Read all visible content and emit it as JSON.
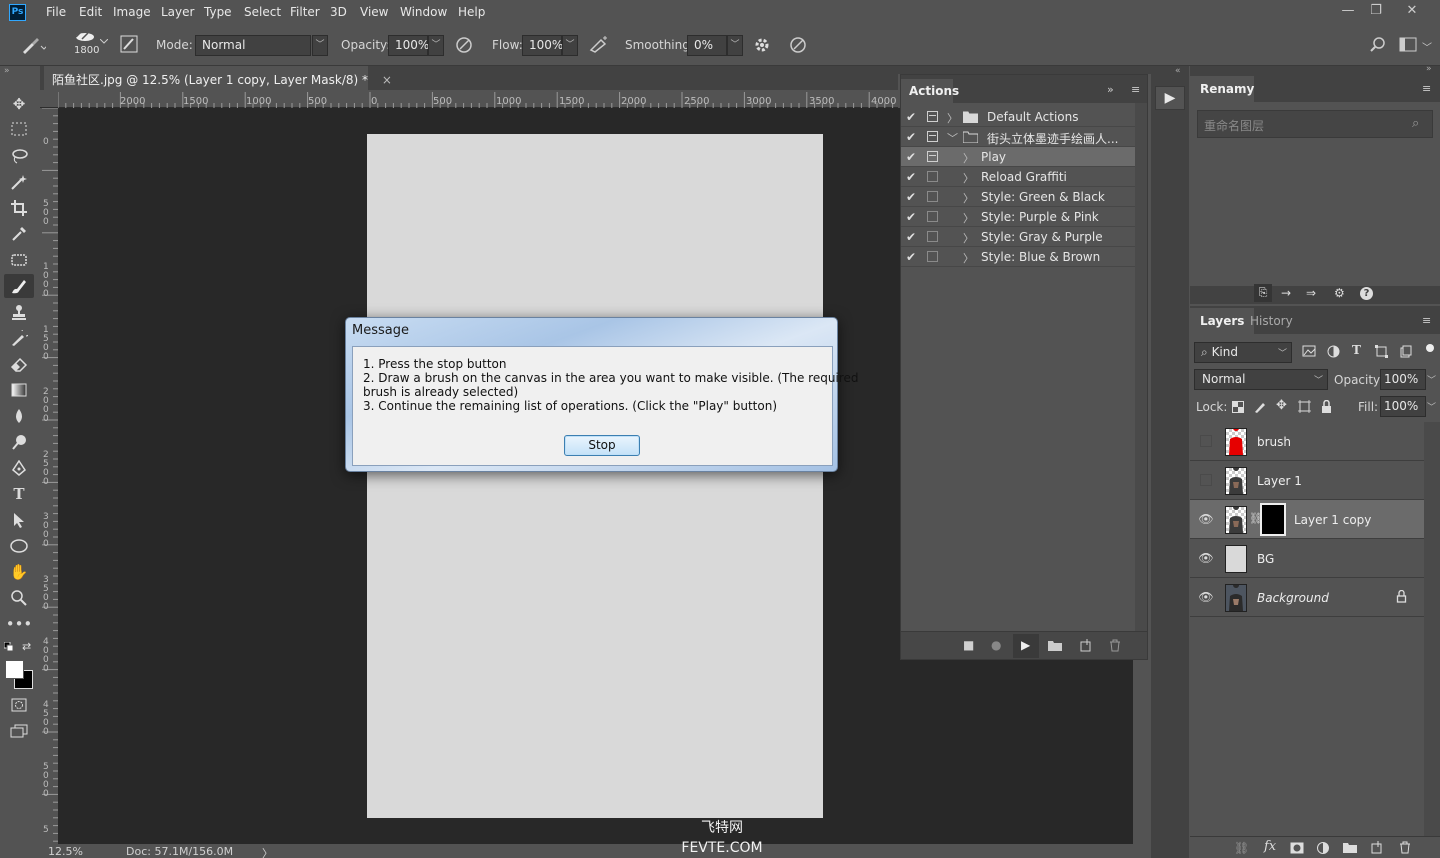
{
  "app": {
    "logo": "Ps"
  },
  "menubar": {
    "items": [
      "File",
      "Edit",
      "Image",
      "Layer",
      "Type",
      "Select",
      "Filter",
      "3D",
      "View",
      "Window",
      "Help"
    ]
  },
  "window_controls": {
    "minimize": "—",
    "restore": "❐",
    "close": "✕"
  },
  "options": {
    "brush_size": "1800",
    "mode_label": "Mode:",
    "mode_value": "Normal",
    "opacity_label": "Opacity:",
    "opacity_value": "100%",
    "flow_label": "Flow:",
    "flow_value": "100%",
    "smoothing_label": "Smoothing:",
    "smoothing_value": "0%"
  },
  "document": {
    "tab_title": "陌鱼社区.jpg @ 12.5% (Layer 1 copy, Layer Mask/8) *",
    "tab_close": "×",
    "ruler_h": [
      "2000",
      "1500",
      "1000",
      "500",
      "0",
      "500",
      "1000",
      "1500",
      "2000",
      "2500",
      "3000",
      "3500",
      "4000"
    ],
    "ruler_v": [
      "0",
      "500",
      "1000",
      "1500",
      "2000",
      "2500",
      "3000",
      "3500",
      "4000",
      "4500",
      "5000",
      "5"
    ]
  },
  "status": {
    "zoom": "12.5%",
    "doc": "Doc: 57.1M/156.0M",
    "arrow": "〉"
  },
  "dialog": {
    "title": "Message",
    "lines": [
      "1. Press the stop button",
      "2. Draw a brush on the canvas in the area you want to make visible. (The required",
      "brush is already selected)",
      "3. Continue the remaining list of operations. (Click the \"Play\" button)"
    ],
    "button": "Stop"
  },
  "actions": {
    "tab": "Actions",
    "rows": [
      {
        "label": "Default Actions",
        "checked": true,
        "dialog": true,
        "type": "set",
        "expand": "〉"
      },
      {
        "label": "街头立体墨迹手绘画人...",
        "checked": true,
        "dialog": true,
        "type": "set-open",
        "expand": "﹀"
      },
      {
        "label": "Play",
        "checked": true,
        "dialog": true,
        "type": "action",
        "expand": "〉"
      },
      {
        "label": "Reload Graffiti",
        "checked": true,
        "dialog": false,
        "type": "action",
        "expand": "〉"
      },
      {
        "label": "Style: Green & Black",
        "checked": true,
        "dialog": false,
        "type": "action",
        "expand": "〉"
      },
      {
        "label": "Style: Purple & Pink",
        "checked": true,
        "dialog": false,
        "type": "action",
        "expand": "〉"
      },
      {
        "label": "Style: Gray & Purple",
        "checked": true,
        "dialog": false,
        "type": "action",
        "expand": "〉"
      },
      {
        "label": "Style: Blue & Brown",
        "checked": true,
        "dialog": false,
        "type": "action",
        "expand": "〉"
      }
    ],
    "check_glyph": "✔",
    "footer": {
      "stop": "■",
      "record": "●",
      "play": "▶",
      "new_set": "▬",
      "new_action": "◫",
      "delete": "🗑"
    }
  },
  "play_mid": "▶",
  "renamy": {
    "tab": "Renamy",
    "placeholder": "重命名图层",
    "search": "⌕"
  },
  "layers": {
    "tabs": [
      "Layers",
      "History"
    ],
    "kind": "Kind",
    "blend": "Normal",
    "opacity_label": "Opacity:",
    "opacity_value": "100%",
    "lock_label": "Lock:",
    "fill_label": "Fill:",
    "fill_value": "100%",
    "eye": "👁",
    "items": [
      {
        "name": "brush",
        "visible": false
      },
      {
        "name": "Layer 1",
        "visible": false
      },
      {
        "name": "Layer 1 copy",
        "visible": true,
        "selected": true
      },
      {
        "name": "BG",
        "visible": true
      },
      {
        "name": "Background",
        "visible": true,
        "locked": true
      }
    ]
  },
  "watermark": {
    "line1": "飞特网",
    "line2": "FEVTE.COM"
  },
  "colors": {
    "accent": "#31a8ff",
    "panel": "#535353",
    "dark": "#424242",
    "canvas_bg": "#282828"
  }
}
